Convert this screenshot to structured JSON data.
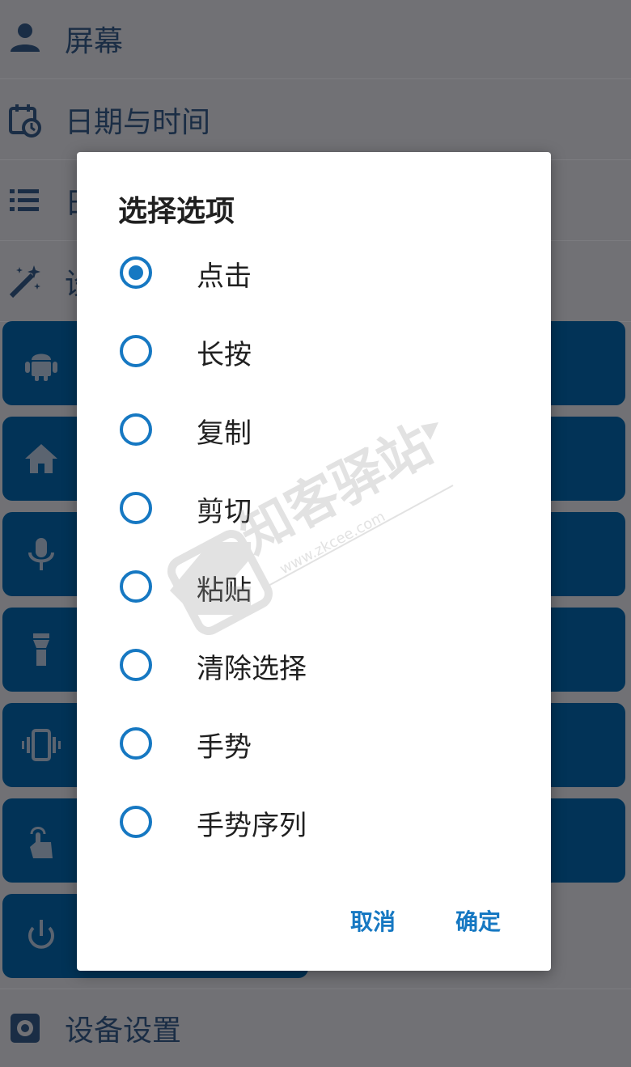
{
  "background_list": {
    "rows_top": [
      {
        "label": "屏幕",
        "icon": "person-icon"
      },
      {
        "label": "日期与时间",
        "icon": "calendar-clock-icon"
      },
      {
        "label": "日",
        "icon": "list-icon"
      },
      {
        "label": "设",
        "icon": "magic-wand-icon"
      }
    ],
    "tiles": [
      {
        "icon": "android-icon"
      },
      {
        "icon": "home-icon"
      },
      {
        "icon": "microphone-icon"
      },
      {
        "icon": "flashlight-icon"
      },
      {
        "icon": "vibrate-icon"
      },
      {
        "icon": "touch-icon"
      },
      {
        "icon": "power-icon"
      }
    ],
    "rows_bottom": [
      {
        "label": "设备设置",
        "icon": "gear-icon"
      }
    ]
  },
  "dialog": {
    "title": "选择选项",
    "selected_index": 0,
    "options": [
      {
        "label": "点击",
        "checked": true
      },
      {
        "label": "长按",
        "checked": false
      },
      {
        "label": "复制",
        "checked": false
      },
      {
        "label": "剪切",
        "checked": false
      },
      {
        "label": "粘贴",
        "checked": false
      },
      {
        "label": "清除选择",
        "checked": false
      },
      {
        "label": "手势",
        "checked": false
      },
      {
        "label": "手势序列",
        "checked": false
      }
    ],
    "cancel_label": "取消",
    "ok_label": "确定"
  },
  "watermark": {
    "brand": "知客驿站",
    "url": "www.zkcee.com",
    "logo_letter": "Z"
  },
  "colors": {
    "scrim": "#717175",
    "tile": "#023357",
    "accent": "#1678c2",
    "dialog_bg": "#ffffff"
  }
}
